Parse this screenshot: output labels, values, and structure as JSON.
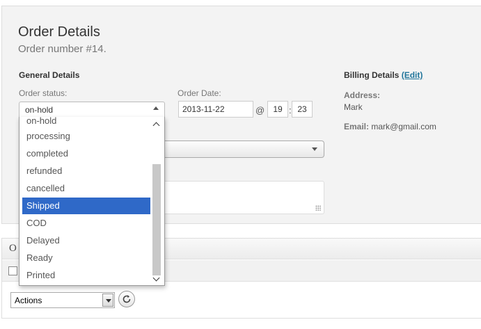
{
  "header": {
    "title": "Order Details",
    "subtitle": "Order number #14."
  },
  "general": {
    "heading": "General Details",
    "status_label": "Order status:",
    "status_value": "on-hold",
    "date_label": "Order Date:",
    "date_value": "2013-11-22",
    "at_symbol": "@",
    "hour": "19",
    "minute_separator": ":",
    "minute": "23"
  },
  "status_dropdown": {
    "partial_option": "on-hold",
    "options": [
      "processing",
      "completed",
      "refunded",
      "cancelled",
      "Shipped",
      "COD",
      "Delayed",
      "Ready",
      "Printed"
    ],
    "selected_index": 4
  },
  "billing": {
    "heading": "Billing Details",
    "edit_link": "(Edit)",
    "address_label": "Address:",
    "address_value": "Mark",
    "email_label": "Email:",
    "email_value": "mark@gmail.com"
  },
  "notes_box": {
    "header_visible_text": "O"
  },
  "bulk": {
    "actions_value": "Actions"
  },
  "colors": {
    "selected_bg": "#2f69c8",
    "link": "#21759b",
    "panel_bg": "#f3f3f3"
  }
}
